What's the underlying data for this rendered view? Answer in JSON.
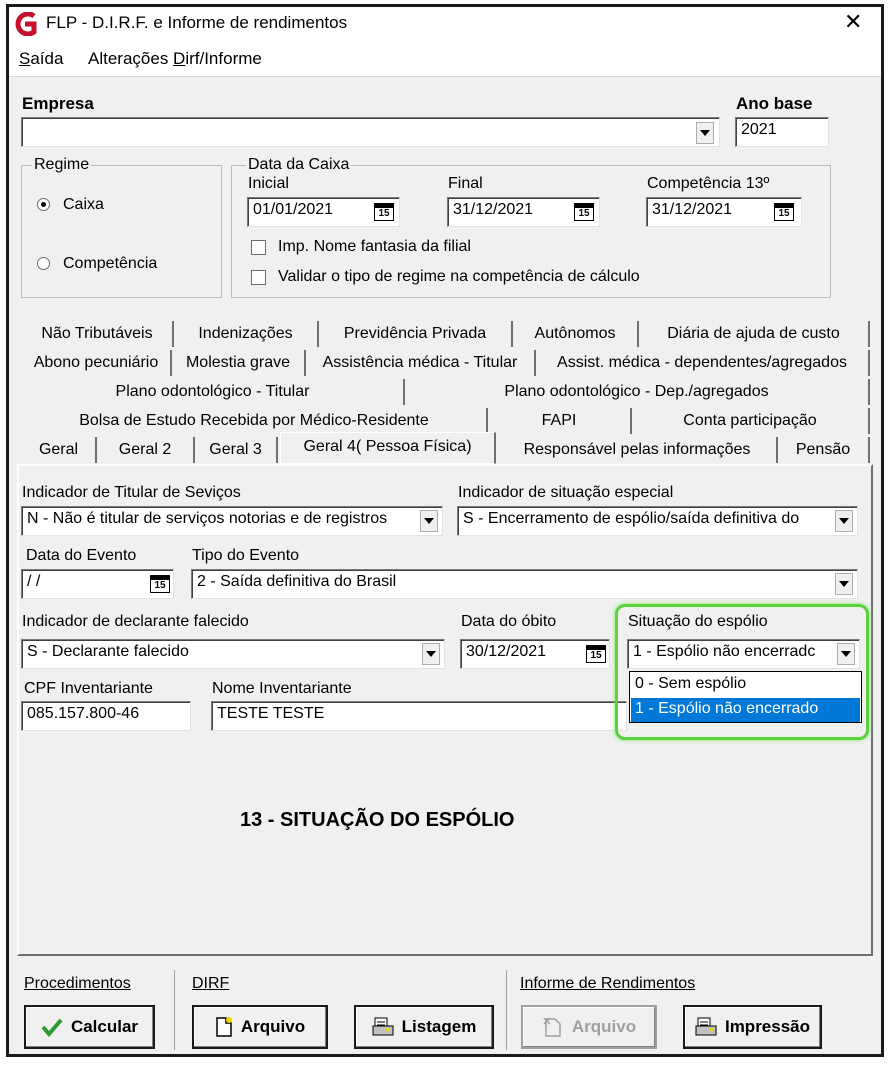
{
  "window": {
    "title": "FLP - D.I.R.F. e Informe de rendimentos",
    "close": "✕"
  },
  "menu": {
    "items": [
      "Saída",
      "Alterações Dirf/Informe"
    ]
  },
  "empresa": {
    "label": "Empresa",
    "value": ""
  },
  "ano_base": {
    "label": "Ano base",
    "value": "2021"
  },
  "regime": {
    "label": "Regime",
    "options": [
      "Caixa",
      "Competência"
    ],
    "selected": "Caixa"
  },
  "data_caixa": {
    "label": "Data da Caixa",
    "inicial_label": "Inicial",
    "inicial": "01/01/2021",
    "final_label": "Final",
    "final": "31/12/2021",
    "comp13_label": "Competência 13º",
    "comp13": "31/12/2021",
    "cal_text": "15",
    "check1": "Imp. Nome fantasia da filial",
    "check2": "Validar o tipo de regime na competência de cálculo"
  },
  "tabs": {
    "row1": [
      "Não Tributáveis",
      "Indenizações",
      "Previdência Privada",
      "Autônomos",
      "Diária de ajuda de custo"
    ],
    "row2": [
      "Abono pecuniário",
      "Molestia grave",
      "Assistência médica - Titular",
      "Assist. médica - dependentes/agregados"
    ],
    "row3": [
      "Plano odontológico - Titular",
      "Plano odontológico - Dep./agregados"
    ],
    "row4": [
      "Bolsa de Estudo Recebida por Médico-Residente",
      "FAPI",
      "Conta participação"
    ],
    "row5": [
      "Geral",
      "Geral 2",
      "Geral 3",
      "Geral 4( Pessoa Física)",
      "Responsável pelas informações",
      "Pensão"
    ]
  },
  "form": {
    "titular_label": "Indicador de Titular de Seviços",
    "titular_value": "N - Não é titular de serviços notorias e de registros",
    "situacao_label": "Indicador de situação especial",
    "situacao_value": "S - Encerramento de espólio/saída definitiva do",
    "data_evento_label": "Data do Evento",
    "data_evento_value": " / /",
    "tipo_evento_label": "Tipo do Evento",
    "tipo_evento_value": "2 - Saída definitiva do Brasil",
    "falecido_label": "Indicador de declarante falecido",
    "falecido_value": "S - Declarante falecido",
    "obito_label": "Data do óbito",
    "obito_value": "30/12/2021",
    "espolio_label": "Situação do espólio",
    "espolio_value": "1 - Espólio não encerradc",
    "espolio_options": [
      "0 - Sem espólio",
      "1 - Espólio não encerrado"
    ],
    "cpf_label": "CPF Inventariante",
    "cpf_value": "085.157.800-46",
    "nome_label": "Nome Inventariante",
    "nome_value": "TESTE TESTE",
    "annotation": "13 - SITUAÇÃO DO ESPÓLIO"
  },
  "footer": {
    "procedimentos": "Procedimentos",
    "dirf": "DIRF",
    "informe": "Informe de Rendimentos",
    "calcular": "Calcular",
    "arquivo": "Arquivo",
    "listagem": "Listagem",
    "arquivo2": "Arquivo",
    "impressao": "Impressão"
  },
  "colors": {
    "highlight": "#0078d7",
    "annotation_border": "#5ad23c",
    "app_icon": "#c8102e"
  }
}
